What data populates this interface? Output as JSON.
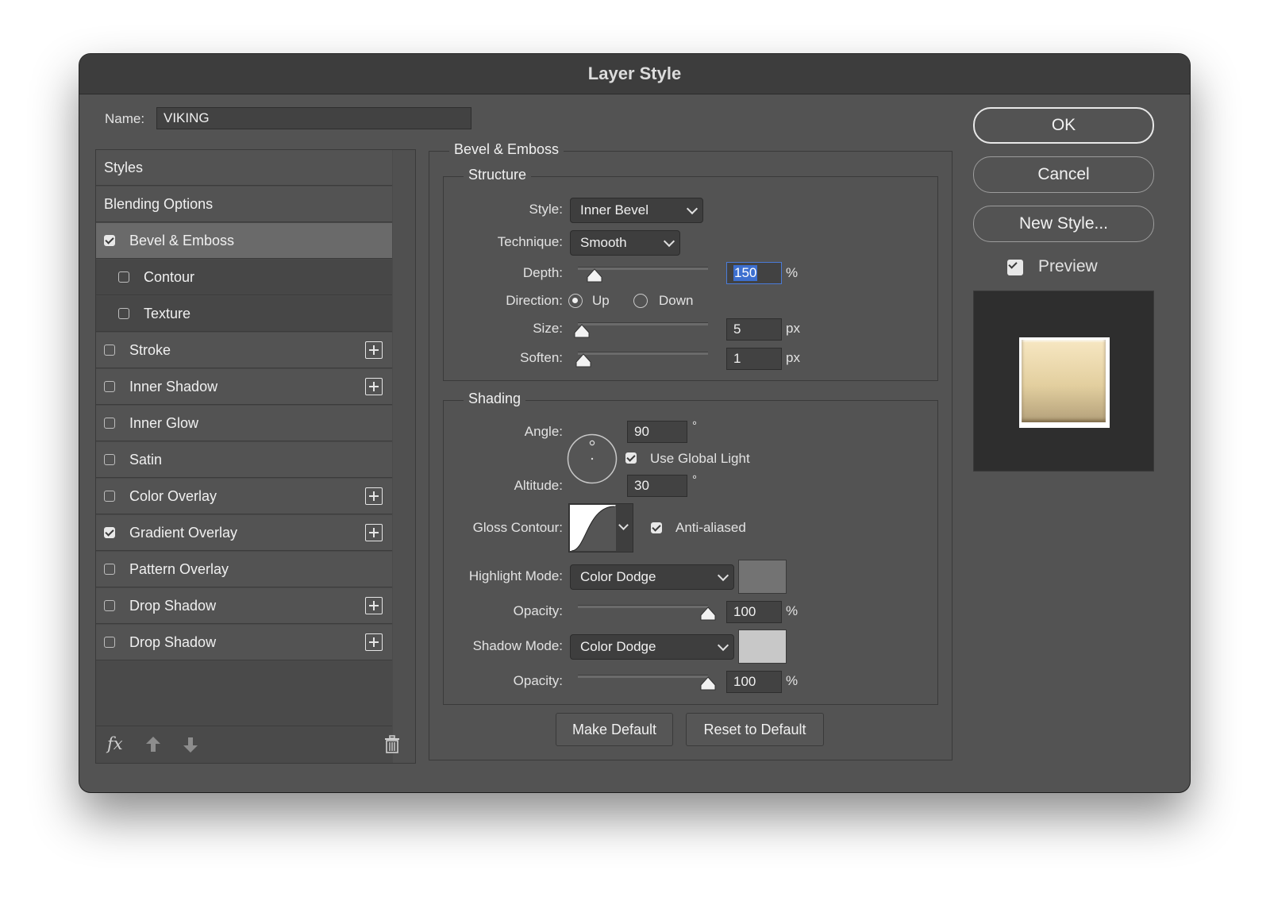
{
  "window": {
    "title": "Layer Style"
  },
  "name_field": {
    "label": "Name:",
    "value": "VIKING"
  },
  "styles_list": {
    "items": [
      {
        "label": "Styles",
        "checkbox": false,
        "checked": false,
        "plus": false,
        "selected": false,
        "indent": false
      },
      {
        "label": "Blending Options",
        "checkbox": false,
        "checked": false,
        "plus": false,
        "selected": false,
        "indent": false
      },
      {
        "label": "Bevel & Emboss",
        "checkbox": true,
        "checked": true,
        "plus": false,
        "selected": true,
        "indent": false
      },
      {
        "label": "Contour",
        "checkbox": true,
        "checked": false,
        "plus": false,
        "selected": false,
        "indent": true
      },
      {
        "label": "Texture",
        "checkbox": true,
        "checked": false,
        "plus": false,
        "selected": false,
        "indent": true
      },
      {
        "label": "Stroke",
        "checkbox": true,
        "checked": false,
        "plus": true,
        "selected": false,
        "indent": false
      },
      {
        "label": "Inner Shadow",
        "checkbox": true,
        "checked": false,
        "plus": true,
        "selected": false,
        "indent": false
      },
      {
        "label": "Inner Glow",
        "checkbox": true,
        "checked": false,
        "plus": false,
        "selected": false,
        "indent": false
      },
      {
        "label": "Satin",
        "checkbox": true,
        "checked": false,
        "plus": false,
        "selected": false,
        "indent": false
      },
      {
        "label": "Color Overlay",
        "checkbox": true,
        "checked": false,
        "plus": true,
        "selected": false,
        "indent": false
      },
      {
        "label": "Gradient Overlay",
        "checkbox": true,
        "checked": true,
        "plus": true,
        "selected": false,
        "indent": false
      },
      {
        "label": "Pattern Overlay",
        "checkbox": true,
        "checked": false,
        "plus": false,
        "selected": false,
        "indent": false
      },
      {
        "label": "Drop Shadow",
        "checkbox": true,
        "checked": false,
        "plus": true,
        "selected": false,
        "indent": false
      },
      {
        "label": "Drop Shadow",
        "checkbox": true,
        "checked": false,
        "plus": true,
        "selected": false,
        "indent": false
      }
    ],
    "footer": {
      "fx": "fx"
    }
  },
  "bevel": {
    "title": "Bevel & Emboss",
    "structure": {
      "title": "Structure",
      "style_label": "Style:",
      "style_value": "Inner Bevel",
      "technique_label": "Technique:",
      "technique_value": "Smooth",
      "depth_label": "Depth:",
      "depth_value": "150",
      "depth_unit": "%",
      "depth_level": 0.13,
      "direction_label": "Direction:",
      "dir_up": "Up",
      "dir_down": "Down",
      "direction_selected": "Up",
      "size_label": "Size:",
      "size_value": "5",
      "size_unit": "px",
      "size_level": 0.03,
      "soften_label": "Soften:",
      "soften_value": "1",
      "soften_unit": "px",
      "soften_level": 0.04
    },
    "shading": {
      "title": "Shading",
      "angle_label": "Angle:",
      "angle_value": "90",
      "degree": "°",
      "global_light_label": "Use Global Light",
      "global_light_checked": true,
      "altitude_label": "Altitude:",
      "altitude_value": "30",
      "gloss_label": "Gloss Contour:",
      "anti_aliased_label": "Anti-aliased",
      "anti_aliased_checked": true,
      "highlight_label": "Highlight Mode:",
      "highlight_value": "Color Dodge",
      "highlight_color": "#737373",
      "hl_opacity_label": "Opacity:",
      "hl_opacity_value": "100",
      "hl_opacity_unit": "%",
      "hl_opacity_level": 1.0,
      "shadow_label": "Shadow Mode:",
      "shadow_value": "Color Dodge",
      "shadow_color": "#c8c8c8",
      "sh_opacity_label": "Opacity:",
      "sh_opacity_value": "100",
      "sh_opacity_unit": "%",
      "sh_opacity_level": 1.0
    },
    "make_default": "Make Default",
    "reset_default": "Reset to Default"
  },
  "actions": {
    "ok": "OK",
    "cancel": "Cancel",
    "new_style": "New Style...",
    "preview_label": "Preview",
    "preview_checked": true
  }
}
